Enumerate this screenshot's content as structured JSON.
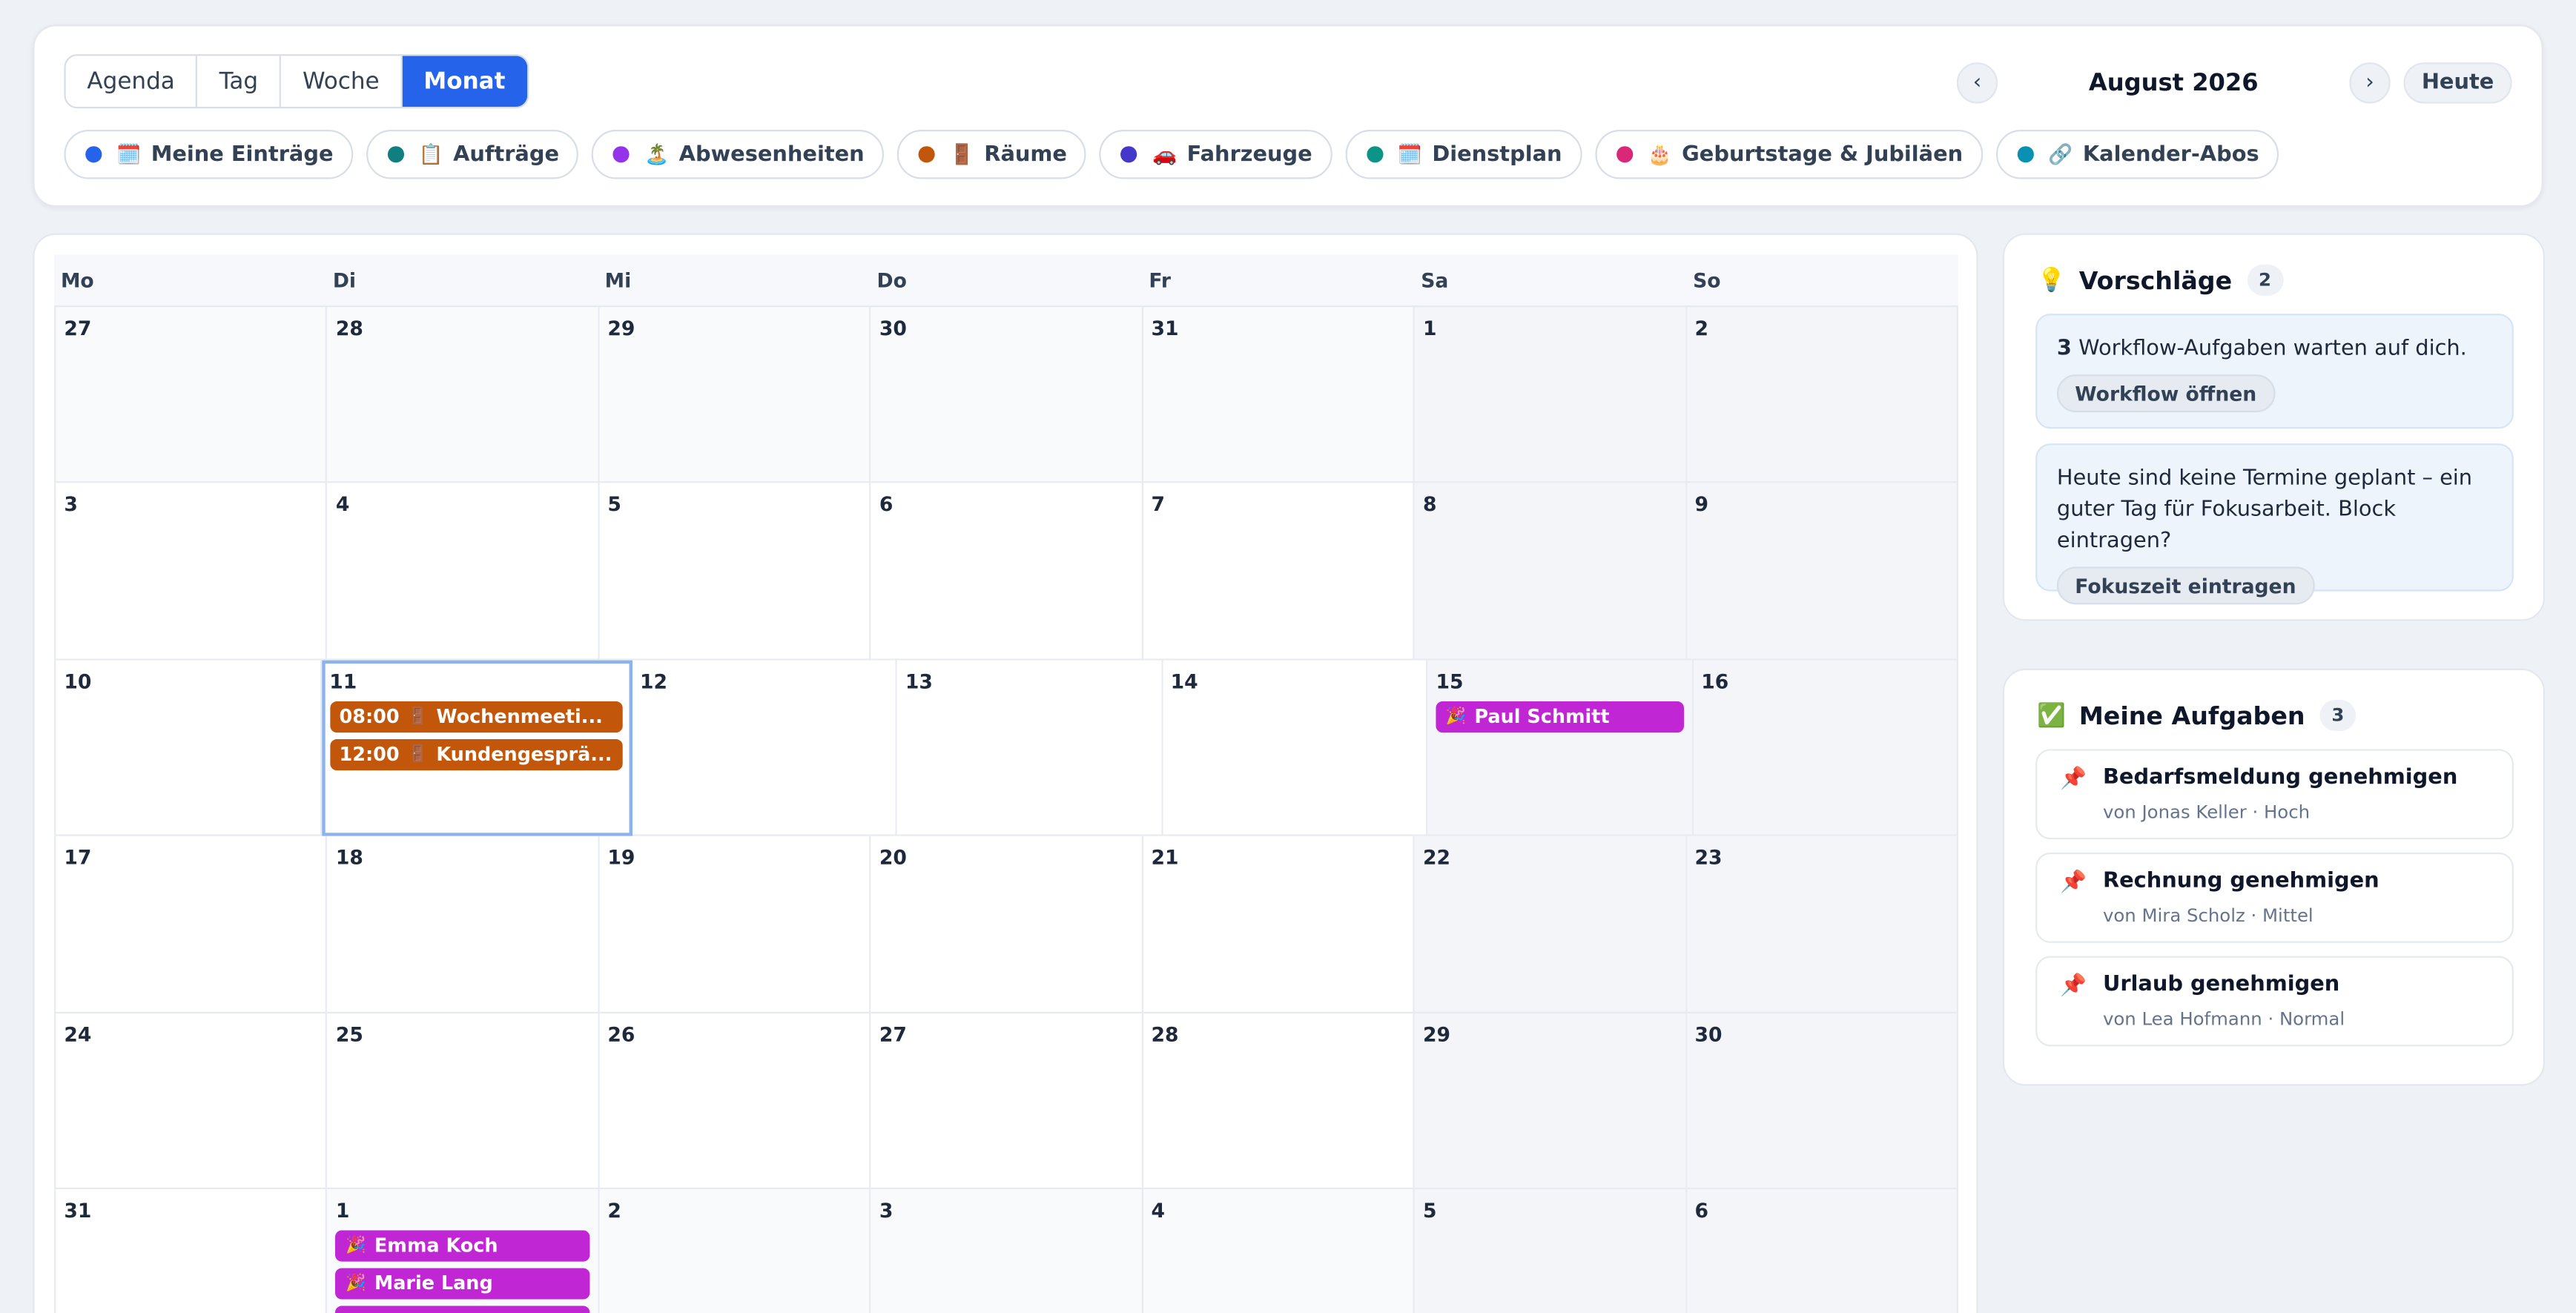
{
  "view_tabs": [
    "Agenda",
    "Tag",
    "Woche",
    "Monat"
  ],
  "active_view": "Monat",
  "nav": {
    "prev": "‹",
    "title": "August 2026",
    "next": "›",
    "today": "Heute"
  },
  "filters": [
    {
      "label": "Meine Einträge",
      "emoji": "🗓️",
      "color": "#2563eb"
    },
    {
      "label": "Aufträge",
      "emoji": "📋",
      "color": "#0f7f80"
    },
    {
      "label": "Abwesenheiten",
      "emoji": "🏝️",
      "color": "#9333ea"
    },
    {
      "label": "Räume",
      "emoji": "🚪",
      "color": "#c2570c"
    },
    {
      "label": "Fahrzeuge",
      "emoji": "🚗",
      "color": "#4338ca"
    },
    {
      "label": "Dienstplan",
      "emoji": "🗓️",
      "color": "#0d9488"
    },
    {
      "label": "Geburtstage & Jubiläen",
      "emoji": "🎂",
      "color": "#db2777"
    },
    {
      "label": "Kalender-Abos",
      "emoji": "🔗",
      "color": "#0891b2"
    }
  ],
  "weekdays": [
    "Mo",
    "Di",
    "Mi",
    "Do",
    "Fr",
    "Sa",
    "So"
  ],
  "weeks": [
    [
      "27",
      "28",
      "29",
      "30",
      "31",
      "1",
      "2"
    ],
    [
      "3",
      "4",
      "5",
      "6",
      "7",
      "8",
      "9"
    ],
    [
      "10",
      "11",
      "12",
      "13",
      "14",
      "15",
      "16"
    ],
    [
      "17",
      "18",
      "19",
      "20",
      "21",
      "22",
      "23"
    ],
    [
      "24",
      "25",
      "26",
      "27",
      "28",
      "29",
      "30"
    ],
    [
      "31",
      "1",
      "2",
      "3",
      "4",
      "5",
      "6"
    ]
  ],
  "events": {
    "wochenmeeting": {
      "time": "08:00",
      "emoji": "🚪",
      "title": "Wochenmeeti..."
    },
    "kundengespraech": {
      "time": "12:00",
      "emoji": "🚪",
      "title": "Kundengesprä..."
    },
    "paul": {
      "emoji": "🎉",
      "title": "Paul Schmitt"
    },
    "emma": {
      "emoji": "🎉",
      "title": "Emma Koch"
    },
    "marie": {
      "emoji": "🎉",
      "title": "Marie Lang"
    }
  },
  "suggestions": {
    "title": "Vorschläge",
    "emoji": "💡",
    "count": "2",
    "s1_count": "3",
    "s1_text": "Workflow-Aufgaben warten auf dich.",
    "s1_button": "Workflow öffnen",
    "s2_text": "Heute sind keine Termine geplant – ein guter Tag für Fokusarbeit. Block eintragen?",
    "s2_button": "Fokuszeit eintragen"
  },
  "tasks": {
    "title": "Meine Aufgaben",
    "emoji": "✅",
    "count": "3",
    "items": [
      {
        "title": "Bedarfsmeldung genehmigen",
        "sub": "von Jonas Keller · Hoch"
      },
      {
        "title": "Rechnung genehmigen",
        "sub": "von Mira Scholz · Mittel"
      },
      {
        "title": "Urlaub genehmigen",
        "sub": "von Lea Hofmann · Normal"
      }
    ]
  }
}
